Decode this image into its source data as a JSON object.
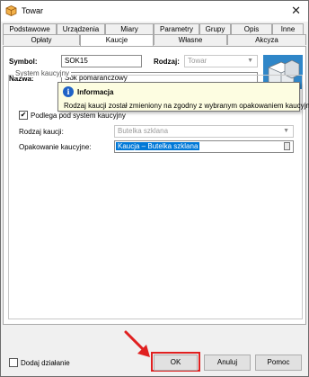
{
  "window": {
    "title": "Towar",
    "close_glyph": "✕",
    "icon": "box-icon"
  },
  "tabs_back": [
    "Podstawowe",
    "Urządzenia",
    "Miary",
    "Parametry",
    "Grupy",
    "Opis",
    "Inne"
  ],
  "tabs_front": [
    "Opłaty",
    "Kaucje",
    "Własne",
    "Akcyza"
  ],
  "active_tab": "Kaucje",
  "form": {
    "symbol_label": "Symbol:",
    "symbol_value": "SOK15",
    "rodzaj_label": "Rodzaj:",
    "rodzaj_value": "Towar",
    "nazwa_label": "Nazwa:",
    "nazwa_value": "Sok pomarańczowy"
  },
  "group": {
    "legend": "System kaucyjny",
    "checkbox_label": "Podlega pod system kaucyjny",
    "checkbox_checked": true,
    "rodzaj_kaucji_label": "Rodzaj kaucji:",
    "rodzaj_kaucji_value": "Butelka szklana",
    "opakowanie_label": "Opakowanie kaucyjne:",
    "opakowanie_value": "Kaucja – Butelka szklana"
  },
  "tooltip": {
    "icon": "info-icon",
    "title": "Informacja",
    "text": "Rodzaj kaucji został zmieniony na zgodny z wybranym opakowaniem kaucyjnym"
  },
  "footer": {
    "dodaj_label": "Dodaj działanie",
    "ok_label": "OK",
    "cancel_label": "Anuluj",
    "help_label": "Pomoc"
  },
  "colors": {
    "highlight": "#e02020",
    "selection": "#0078d7",
    "tooltip_bg": "#fdfde1"
  }
}
